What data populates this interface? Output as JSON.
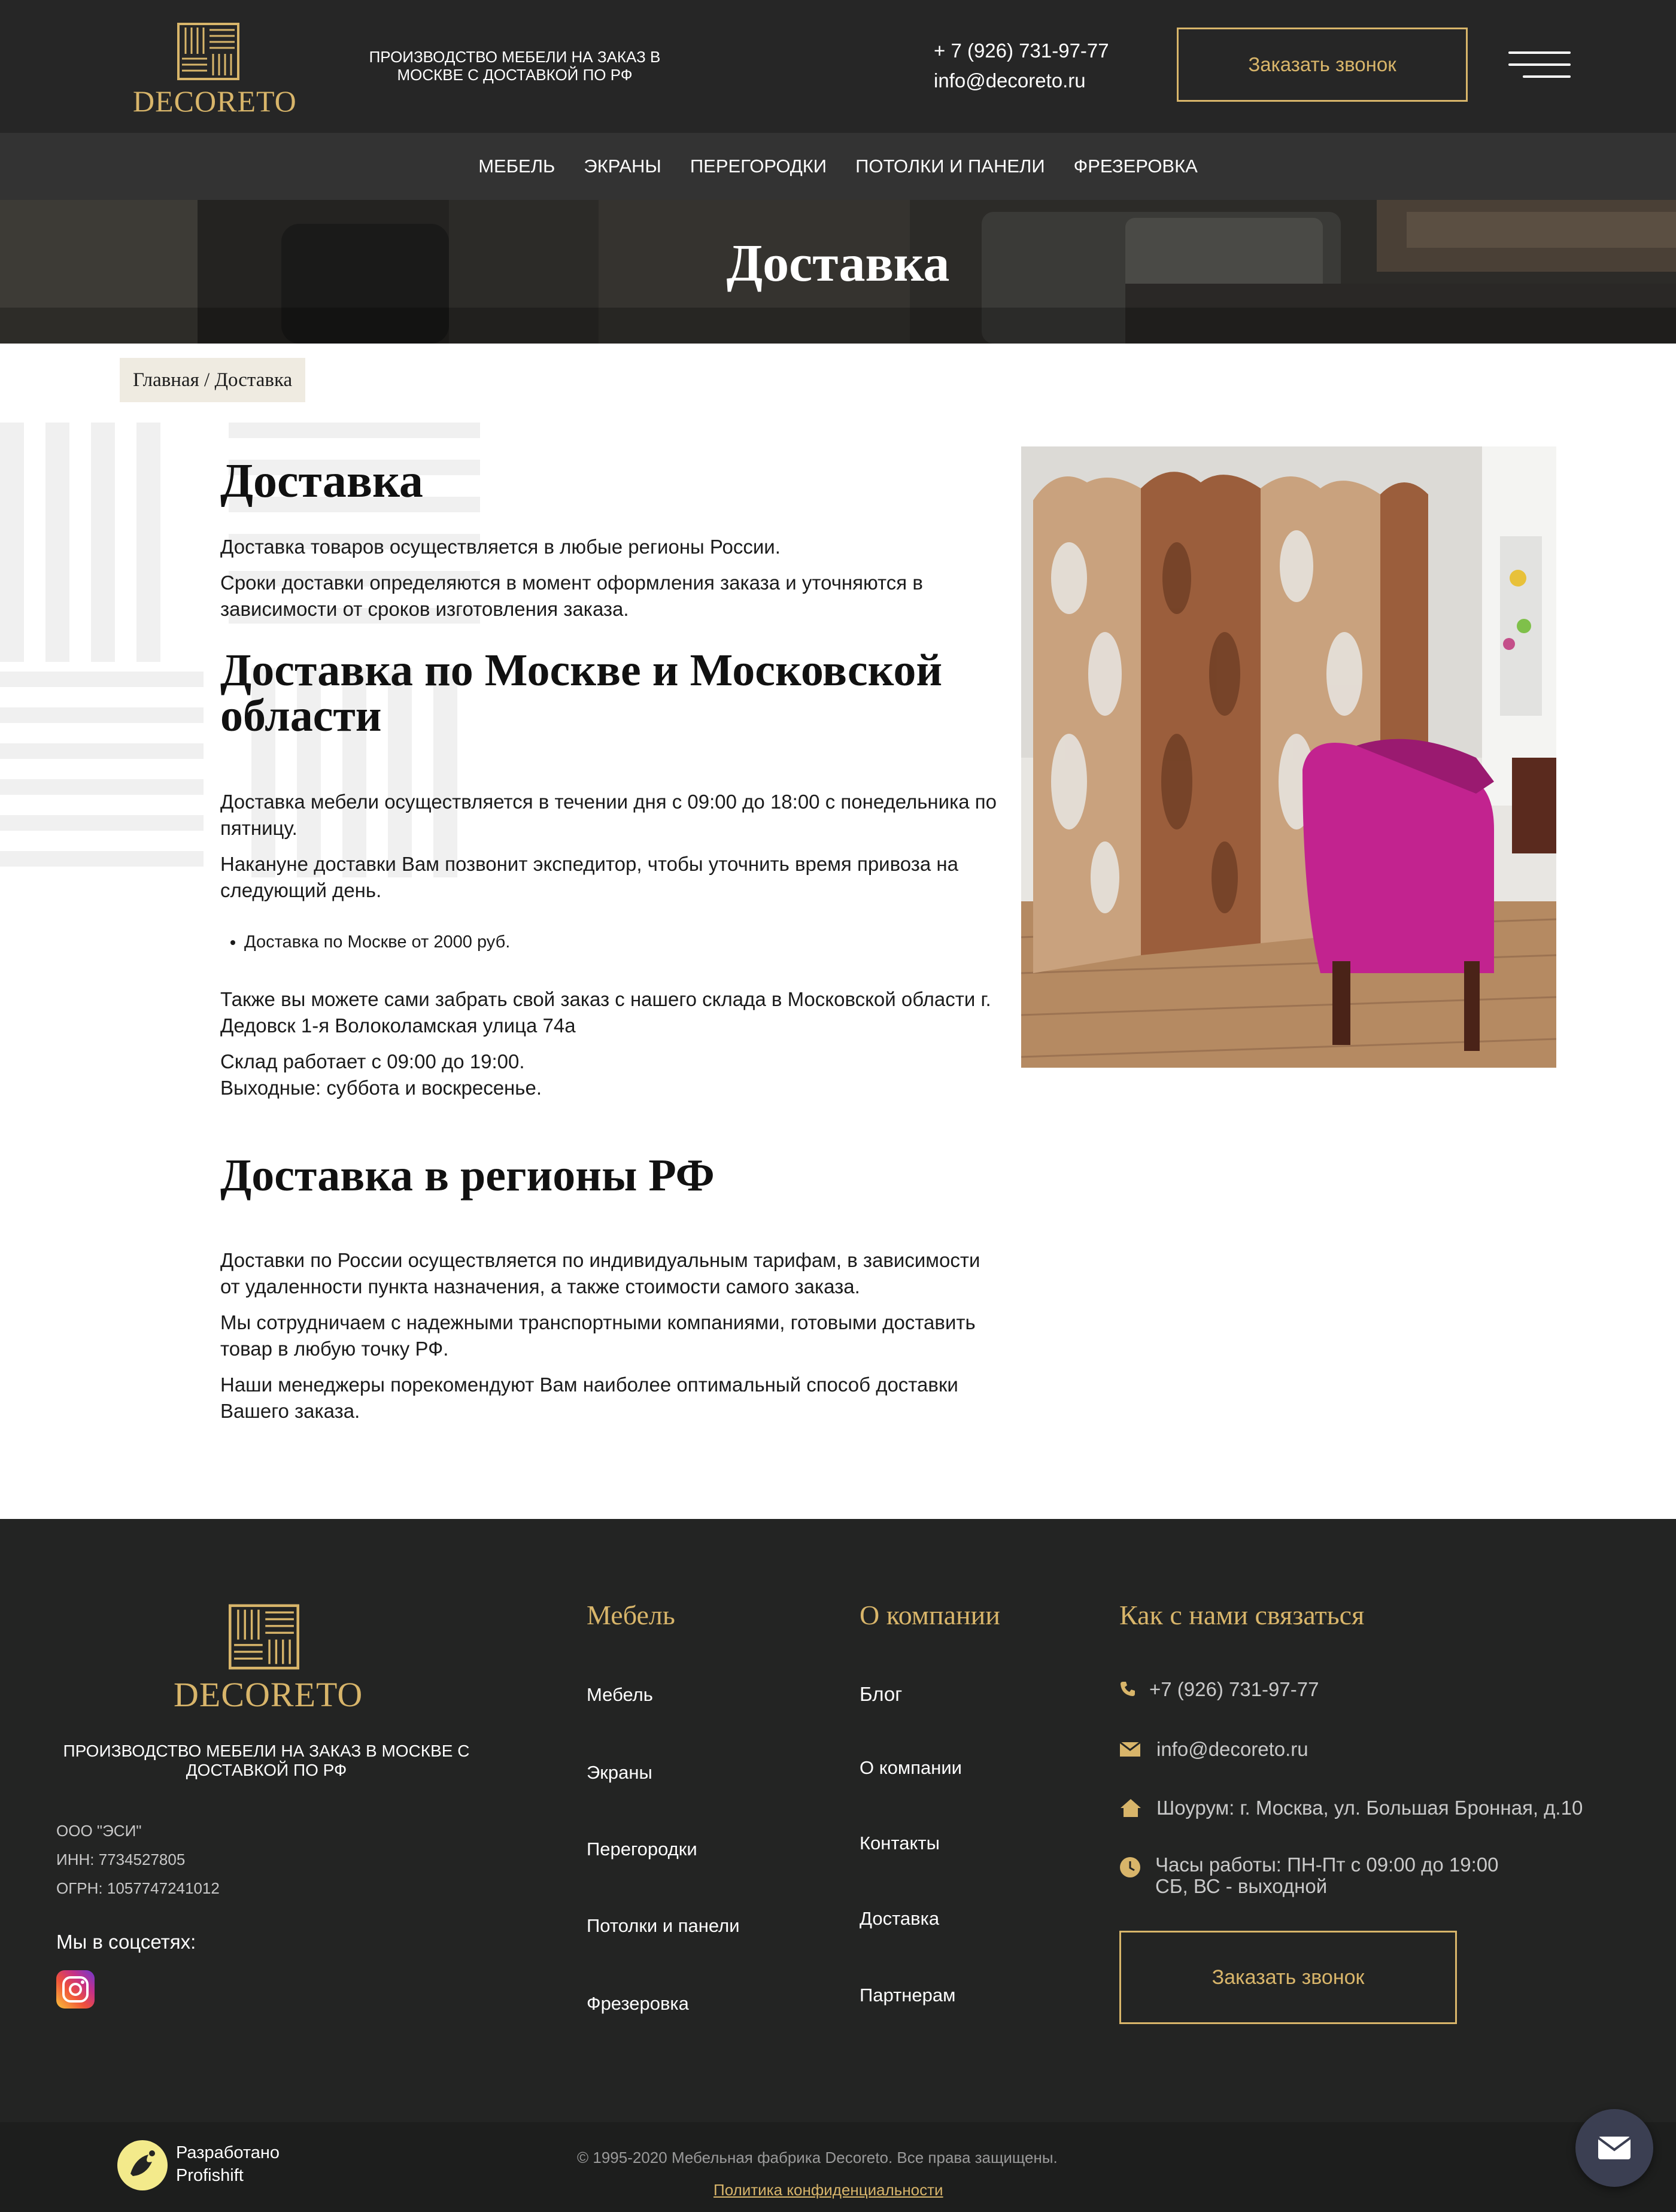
{
  "header": {
    "logo_text": "DECORETO",
    "tagline": "Производство мебели на заказ в Москве с доставкой по РФ",
    "phone": "+ 7 (926) 731-97-77",
    "email": "info@decoreto.ru",
    "call_button": "Заказать звонок",
    "menu_icon": "hamburger-menu-icon"
  },
  "nav": {
    "items": [
      "Мебель",
      "Экраны",
      "Перегородки",
      "Потолки и панели",
      "Фрезеровка"
    ]
  },
  "hero": {
    "title": "Доставка"
  },
  "breadcrumb": {
    "text": "Главная / Доставка"
  },
  "content": {
    "h1": "Доставка",
    "p1": "Доставка товаров осуществляется в любые регионы России.",
    "p2": "Сроки доставки определяются в момент оформления заказа и уточняются в зависимости от сроков изготовления заказа.",
    "h2_moscow": "Доставка по Москве и Московской области",
    "p3": "Доставка мебели осуществляется в течении дня с 09:00 до 18:00 с понедельника по пятницу.",
    "p4": "Накануне доставки Вам позвонит экспедитор, чтобы уточнить время привоза на следующий день.",
    "bullet": "Доставка по Москве от 2000 руб.",
    "p5": "Также вы можете сами забрать свой заказ с нашего склада в Московской области г. Дедовск 1-я Волоколамская улица 74а",
    "p6_line1": "Склад работает с 09:00 до 19:00.",
    "p6_line2": "Выходные: суббота и воскресенье.",
    "h2_regions": "Доставка в регионы РФ",
    "p7": "Доставки по России осуществляется по индивидуальным тарифам, в зависимости от удаленности пункта назначения, а также стоимости самого заказа.",
    "p8": "Мы сотрудничаем с надежными транспортными компаниями, готовыми доставить товар в любую точку РФ.",
    "p9": "Наши менеджеры порекомендуют Вам наиболее оптимальный способ доставки Вашего заказа."
  },
  "footer": {
    "logo_text": "DECORETO",
    "tagline": "Производство мебели на заказ в Москве с доставкой по РФ",
    "company": "ООО \"ЭСИ\"",
    "inn": "ИНН: 7734527805",
    "ogrn": "ОГРН: 1057747241012",
    "social_label": "Мы в соцсетях:",
    "col_furniture": {
      "heading": "Мебель",
      "links": [
        "Мебель",
        "Экраны",
        "Перегородки",
        "Потолки и панели",
        "Фрезеровка"
      ]
    },
    "col_company": {
      "heading": "О компании",
      "links": [
        "Блог",
        "О компании",
        "Контакты",
        "Доставка",
        "Партнерам"
      ]
    },
    "col_contacts": {
      "heading": "Как с нами связаться",
      "phone": "+7 (926) 731-97-77",
      "email": "info@decoreto.ru",
      "showroom": "Шоурум: г. Москва, ул. Большая Бронная, д.10",
      "hours_line1": "Часы работы: ПН-Пт с 09:00 до 19:00",
      "hours_line2": "СБ, ВС - выходной"
    },
    "call_button": "Заказать звонок",
    "developer_line1": "Разработано",
    "developer_line2": "Profishift",
    "copyright": "© 1995-2020 Мебельная фабрика Decoreto. Все права защищены.",
    "privacy": "Политика конфиденциальности"
  },
  "colors": {
    "gold": "#d8b56a",
    "header_bg": "#262626",
    "nav_bg": "#333333",
    "footer_bg": "#232423",
    "chair_magenta": "#c2238f"
  }
}
